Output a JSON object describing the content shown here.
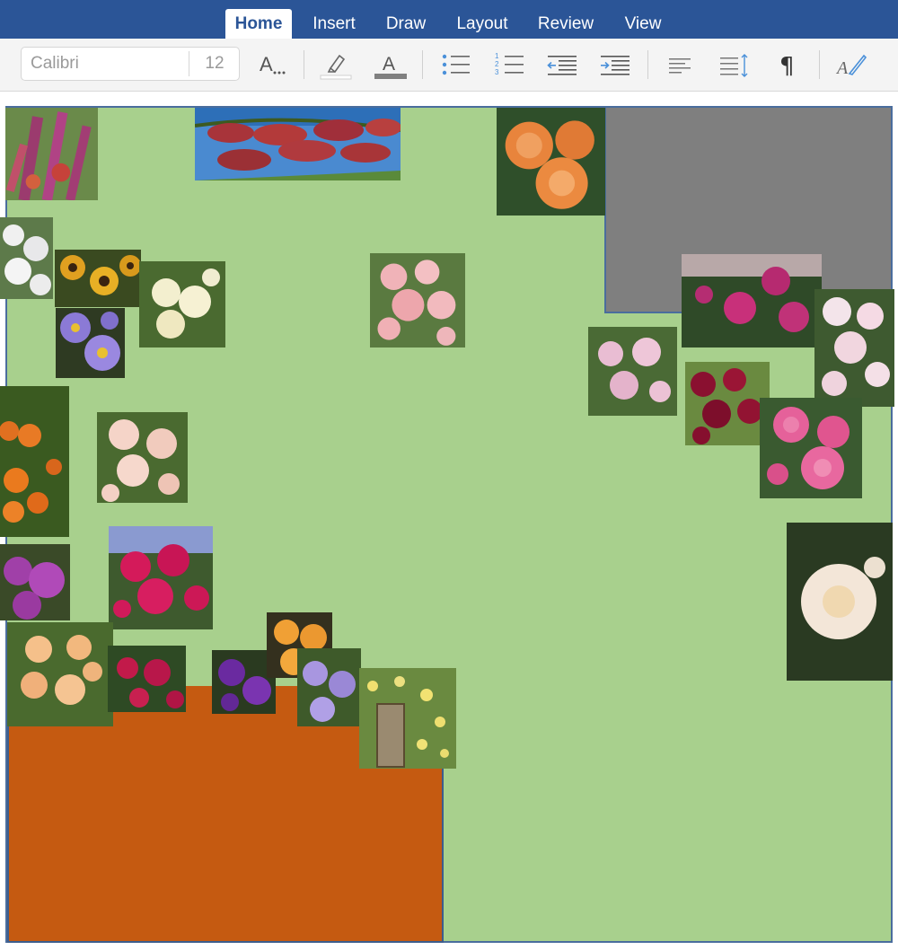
{
  "tabs": [
    {
      "label": "Home",
      "active": true
    },
    {
      "label": "Insert",
      "active": false
    },
    {
      "label": "Draw",
      "active": false
    },
    {
      "label": "Layout",
      "active": false
    },
    {
      "label": "Review",
      "active": false
    },
    {
      "label": "View",
      "active": false
    }
  ],
  "ribbon": {
    "font_name": "Calibri",
    "font_size": "12",
    "font_style_label": "A..",
    "font_color_label": "A",
    "paragraph_mark": "¶",
    "icons": [
      "text-effects-icon",
      "highlighter-icon",
      "font-color-icon",
      "bullet-list-icon",
      "numbered-list-icon",
      "decrease-indent-icon",
      "increase-indent-icon",
      "align-left-icon",
      "line-spacing-icon",
      "paragraph-mark-icon",
      "styles-icon"
    ]
  },
  "colors": {
    "tabbar": "#2b5597",
    "lawn": "#a8d08d",
    "grey_area": "#7f7f7f",
    "orange_area": "#c55a11",
    "outline": "#4a6d9d"
  },
  "photos": [
    "buddleia",
    "apples",
    "orange-rose",
    "white-blossom",
    "rudbeckia",
    "cream-rose",
    "pink-rose-cluster",
    "purple-aster",
    "magenta-rose",
    "white-pink-rose",
    "mauve-rose",
    "crimson-rose",
    "pink-rose",
    "crab-apples",
    "peach-rose",
    "purple-flower",
    "cerise-rose",
    "white-rose",
    "apricot-rose",
    "red-clematis",
    "purple-clematis",
    "orange-rose-small",
    "lilac-clematis",
    "climbing-rose-gate"
  ]
}
